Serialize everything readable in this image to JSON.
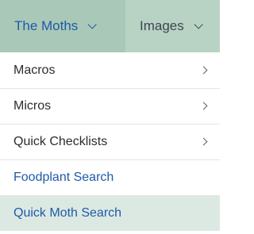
{
  "nav": {
    "tabs": [
      {
        "label": "The Moths",
        "icon": "chevron-down-icon"
      },
      {
        "label": "Images",
        "icon": "chevron-down-icon"
      }
    ]
  },
  "menu": {
    "items": [
      {
        "label": "Macros",
        "icon": "chevron-right-icon"
      },
      {
        "label": "Micros",
        "icon": "chevron-right-icon"
      },
      {
        "label": "Quick Checklists",
        "icon": "chevron-right-icon"
      },
      {
        "label": "Foodplant Search"
      },
      {
        "label": "Quick Moth Search"
      }
    ]
  },
  "colors": {
    "nav_bg": "#a9c8b7",
    "link": "#1f5aa8",
    "active_bg": "#dce9e2"
  }
}
